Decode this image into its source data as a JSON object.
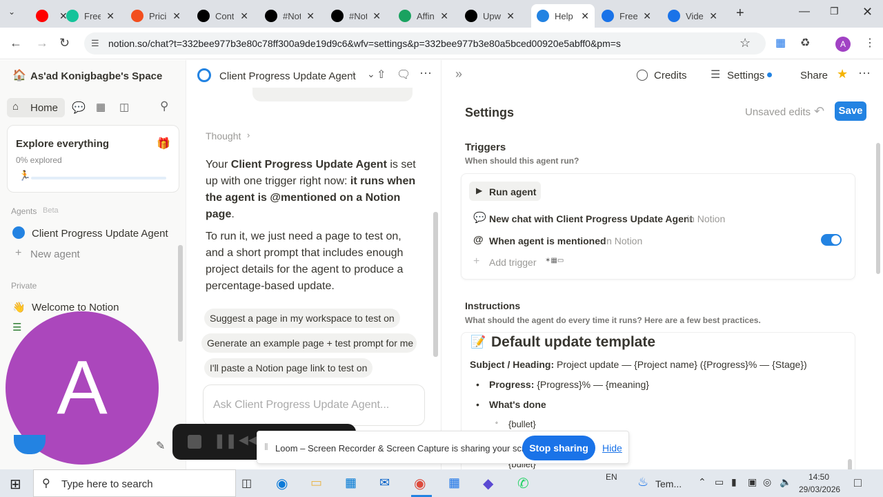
{
  "browser": {
    "tabs": [
      {
        "label": "",
        "icon": "youtube-icon",
        "color": "#ff0000"
      },
      {
        "label": "Free",
        "icon": "grammar-icon",
        "color": "#15c39a"
      },
      {
        "label": "Pricin",
        "icon": "figma-icon",
        "color": "#f24e1e"
      },
      {
        "label": "Cont",
        "icon": "x-icon",
        "color": "#000000"
      },
      {
        "label": "#Not",
        "icon": "notion-icon",
        "color": "#000000"
      },
      {
        "label": "#Not",
        "icon": "notion-icon",
        "color": "#000000"
      },
      {
        "label": "Affin",
        "icon": "affine-icon",
        "color": "#1aa260"
      },
      {
        "label": "Upw",
        "icon": "upwork-icon",
        "color": "#000000"
      },
      {
        "label": "Help",
        "icon": "notion-ai-icon",
        "color": "#2383e2"
      },
      {
        "label": "Free",
        "icon": "gear-icon",
        "color": "#1a73e8"
      },
      {
        "label": "Vide",
        "icon": "gear-icon",
        "color": "#1a73e8"
      }
    ],
    "url": "notion.so/chat?t=332bee977b3e80c78ff300a9de19d9c6&wfv=settings&p=332bee977b3e80a5bced00920e5abff0&pm=s",
    "profile_initial": "A"
  },
  "sidebar": {
    "workspace": "As'ad Konigbagbe's Space",
    "home": "Home",
    "explore_title": "Explore everything",
    "explore_progress": "0% explored",
    "agents_heading": "Agents",
    "agents_badge": "Beta",
    "agent_item": "Client Progress Update Agent",
    "new_agent": "New agent",
    "private_heading": "Private",
    "welcome_item": "Welcome to Notion",
    "avatar_initial": "A"
  },
  "chat": {
    "title": "Client Progress Update Agent",
    "thought": "Thought",
    "p1_a": "Your ",
    "p1_b": "Client Progress Update Agent",
    "p1_c": " is set up with one trigger right now: ",
    "p1_d": "it runs when the agent is @mentioned on a Notion page",
    "p1_e": ".",
    "p2": "To run it, we just need a page to test on, and a short prompt that includes enough project details for the agent to produce a percentage-based update.",
    "suggest1": "Suggest a page in my workspace to test on",
    "suggest2": "Generate an example page + test prompt for me",
    "suggest3": "I'll paste a Notion page link to test on",
    "input_placeholder": "Ask Client Progress Update Agent..."
  },
  "loom": {
    "message": "Loom – Screen Recorder & Screen Capture is sharing your screen.",
    "stop": "Stop sharing",
    "hide": "Hide"
  },
  "settings": {
    "credits": "Credits",
    "settings_label": "Settings",
    "share": "Share",
    "title": "Settings",
    "unsaved": "Unsaved edits",
    "save": "Save",
    "triggers_title": "Triggers",
    "triggers_sub": "When should this agent run?",
    "run_agent": "Run agent",
    "trigger1": "New chat with Client Progress Update Agent",
    "trigger1_in": "in Notion",
    "trigger2": "When agent is mentioned",
    "trigger2_in": "in Notion",
    "add_trigger": "Add trigger",
    "instructions_title": "Instructions",
    "instructions_sub": "What should the agent do every time it runs? Here are a few best practices.",
    "template_title": "Default update template",
    "subject_label": "Subject / Heading:",
    "subject_value": "Project update — {Project name} ({Progress}% — {Stage})",
    "progress_label": "Progress:",
    "progress_value": "{Progress}% — {meaning}",
    "whats_done": "What's done",
    "bullet1": "{bullet}",
    "bullet2": "{bullet}"
  },
  "taskbar": {
    "search_placeholder": "Type here to search",
    "lang": "EN",
    "weather": "Tem...",
    "time": "14:50",
    "date": "29/03/2026"
  }
}
